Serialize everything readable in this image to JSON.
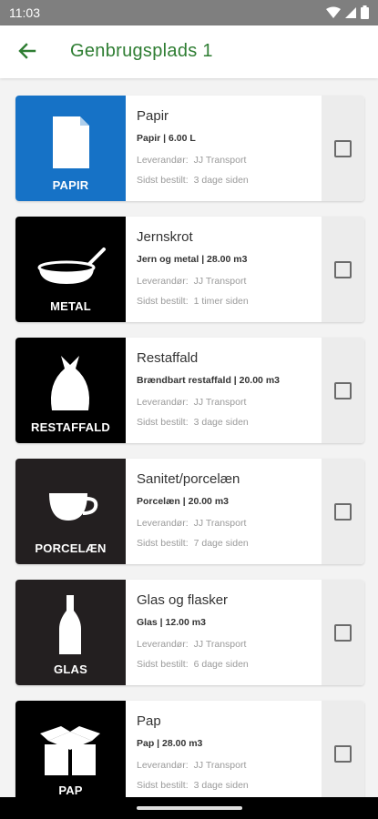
{
  "status": {
    "time": "11:03"
  },
  "header": {
    "title": "Genbrugsplads 1"
  },
  "items": [
    {
      "tile_label": "PAPIR",
      "tile_color": "#1672c6",
      "icon": "paper-icon",
      "title": "Papir",
      "subtitle": "Papir | 6.00 L",
      "supplier_label": "Leverandør:",
      "supplier": "JJ Transport",
      "ordered_label": "Sidst bestilt:",
      "ordered": "3 dage siden"
    },
    {
      "tile_label": "METAL",
      "tile_color": "#000000",
      "icon": "frying-pan-icon",
      "title": "Jernskrot",
      "subtitle": "Jern og metal | 28.00 m3",
      "supplier_label": "Leverandør:",
      "supplier": "JJ Transport",
      "ordered_label": "Sidst bestilt:",
      "ordered": "1 timer siden"
    },
    {
      "tile_label": "RESTAFFALD",
      "tile_color": "#000000",
      "icon": "trash-bag-icon",
      "title": "Restaffald",
      "subtitle": "Brændbart restaffald | 20.00 m3",
      "supplier_label": "Leverandør:",
      "supplier": "JJ Transport",
      "ordered_label": "Sidst bestilt:",
      "ordered": "3 dage siden"
    },
    {
      "tile_label": "PORCELÆN",
      "tile_color": "#231f20",
      "icon": "cup-icon",
      "title": "Sanitet/porcelæn",
      "subtitle": "Porcelæn | 20.00 m3",
      "supplier_label": "Leverandør:",
      "supplier": "JJ Transport",
      "ordered_label": "Sidst bestilt:",
      "ordered": "7 dage siden"
    },
    {
      "tile_label": "GLAS",
      "tile_color": "#231f20",
      "icon": "bottle-icon",
      "title": "Glas og flasker",
      "subtitle": "Glas | 12.00 m3",
      "supplier_label": "Leverandør:",
      "supplier": "JJ Transport",
      "ordered_label": "Sidst bestilt:",
      "ordered": "6 dage siden"
    },
    {
      "tile_label": "PAP",
      "tile_color": "#000000",
      "icon": "cardboard-box-icon",
      "title": "Pap",
      "subtitle": "Pap | 28.00 m3",
      "supplier_label": "Leverandør:",
      "supplier": "JJ Transport",
      "ordered_label": "Sidst bestilt:",
      "ordered": "3 dage siden"
    }
  ]
}
